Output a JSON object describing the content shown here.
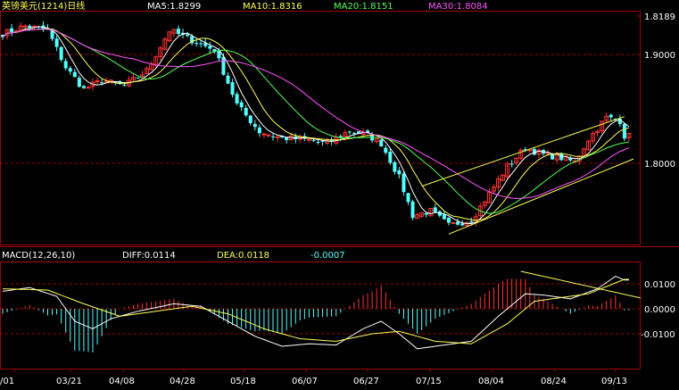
{
  "header": {
    "title": "英镑美元(1214)日线",
    "ma5": "MA5:1.8299",
    "ma10": "MA10:1.8316",
    "ma20": "MA20:1.8151",
    "ma30": "MA30:1.8084"
  },
  "macd_header": {
    "label": "MACD(12,26,10)",
    "diff": "DIFF:0.0114",
    "dea": "DEA:0.0118",
    "macd": "-0.0007"
  },
  "colors": {
    "up": "#ff3232",
    "down": "#54ffff",
    "ma5": "#ffffff",
    "ma10": "#ffff54",
    "ma20": "#54ff54",
    "ma30": "#ff54ff",
    "grid": "#a00000",
    "channel": "#ffff54"
  },
  "chart_data": [
    {
      "type": "candlestick",
      "title": "英镑美元(1214)日线",
      "x_ticks": [
        "/01",
        "03/21",
        "04/08",
        "04/28",
        "05/18",
        "06/07",
        "06/27",
        "07/15",
        "08/04",
        "08/24",
        "09/13"
      ],
      "y_ticks": [
        1.8189,
        1.9,
        1.8
      ],
      "ylim": [
        1.73,
        1.845
      ],
      "grid_lines_at": [
        1.9,
        1.8
      ],
      "last_price": 1.8189,
      "moving_averages": [
        {
          "name": "MA5",
          "last": 1.8299
        },
        {
          "name": "MA10",
          "last": 1.8316
        },
        {
          "name": "MA20",
          "last": 1.8151
        },
        {
          "name": "MA30",
          "last": 1.8084
        }
      ],
      "close_path": [
        [
          0,
          1.919
        ],
        [
          5,
          1.926
        ],
        [
          10,
          1.922
        ],
        [
          14,
          1.888
        ],
        [
          18,
          1.868
        ],
        [
          22,
          1.876
        ],
        [
          27,
          1.871
        ],
        [
          32,
          1.885
        ],
        [
          37,
          1.922
        ],
        [
          42,
          1.913
        ],
        [
          47,
          1.904
        ],
        [
          52,
          1.854
        ],
        [
          57,
          1.829
        ],
        [
          62,
          1.823
        ],
        [
          67,
          1.822
        ],
        [
          72,
          1.818
        ],
        [
          77,
          1.83
        ],
        [
          81,
          1.826
        ],
        [
          84,
          1.818
        ],
        [
          88,
          1.787
        ],
        [
          91,
          1.752
        ],
        [
          95,
          1.756
        ],
        [
          99,
          1.743
        ],
        [
          104,
          1.748
        ],
        [
          108,
          1.772
        ],
        [
          112,
          1.797
        ],
        [
          116,
          1.814
        ],
        [
          120,
          1.808
        ],
        [
          124,
          1.805
        ],
        [
          127,
          1.801
        ],
        [
          130,
          1.822
        ],
        [
          134,
          1.842
        ],
        [
          137,
          1.839
        ],
        [
          138,
          1.825
        ]
      ],
      "channel_lines": [
        {
          "from": [
            93,
            1.779
          ],
          "to": [
            138,
            1.843
          ]
        },
        {
          "from": [
            99,
            1.735
          ],
          "to": [
            140,
            1.804
          ]
        }
      ]
    },
    {
      "type": "bar",
      "title": "MACD(12,26,10)",
      "y_ticks": [
        0.01,
        0.0,
        -0.01
      ],
      "ylim": [
        -0.016,
        0.012
      ],
      "series": [
        {
          "name": "DIFF",
          "last": 0.0114
        },
        {
          "name": "DEA",
          "last": 0.0118
        },
        {
          "name": "MACD",
          "last": -0.0007
        }
      ],
      "diff_path": [
        [
          0,
          0.007
        ],
        [
          6,
          0.0085
        ],
        [
          12,
          0.005
        ],
        [
          16,
          -0.005
        ],
        [
          20,
          -0.008
        ],
        [
          24,
          -0.004
        ],
        [
          30,
          -0.001
        ],
        [
          38,
          0.002
        ],
        [
          44,
          0.001
        ],
        [
          50,
          -0.005
        ],
        [
          56,
          -0.011
        ],
        [
          62,
          -0.015
        ],
        [
          68,
          -0.014
        ],
        [
          74,
          -0.0145
        ],
        [
          80,
          -0.008
        ],
        [
          84,
          -0.005
        ],
        [
          88,
          -0.01
        ],
        [
          92,
          -0.016
        ],
        [
          98,
          -0.0145
        ],
        [
          104,
          -0.013
        ],
        [
          110,
          -0.003
        ],
        [
          116,
          0.006
        ],
        [
          120,
          0.0055
        ],
        [
          126,
          0.004
        ],
        [
          132,
          0.008
        ],
        [
          136,
          0.013
        ],
        [
          138,
          0.0115
        ]
      ],
      "dea_path": [
        [
          0,
          0.008
        ],
        [
          10,
          0.0075
        ],
        [
          18,
          0.002
        ],
        [
          26,
          -0.003
        ],
        [
          34,
          -0.001
        ],
        [
          42,
          0.001
        ],
        [
          50,
          -0.002
        ],
        [
          58,
          -0.008
        ],
        [
          66,
          -0.012
        ],
        [
          74,
          -0.013
        ],
        [
          82,
          -0.01
        ],
        [
          88,
          -0.009
        ],
        [
          96,
          -0.013
        ],
        [
          104,
          -0.014
        ],
        [
          112,
          -0.006
        ],
        [
          118,
          0.003
        ],
        [
          124,
          0.0045
        ],
        [
          130,
          0.006
        ],
        [
          138,
          0.0118
        ]
      ],
      "trendline": {
        "from": [
          115,
          0.015
        ],
        "to": [
          140,
          0.0045
        ]
      }
    }
  ]
}
